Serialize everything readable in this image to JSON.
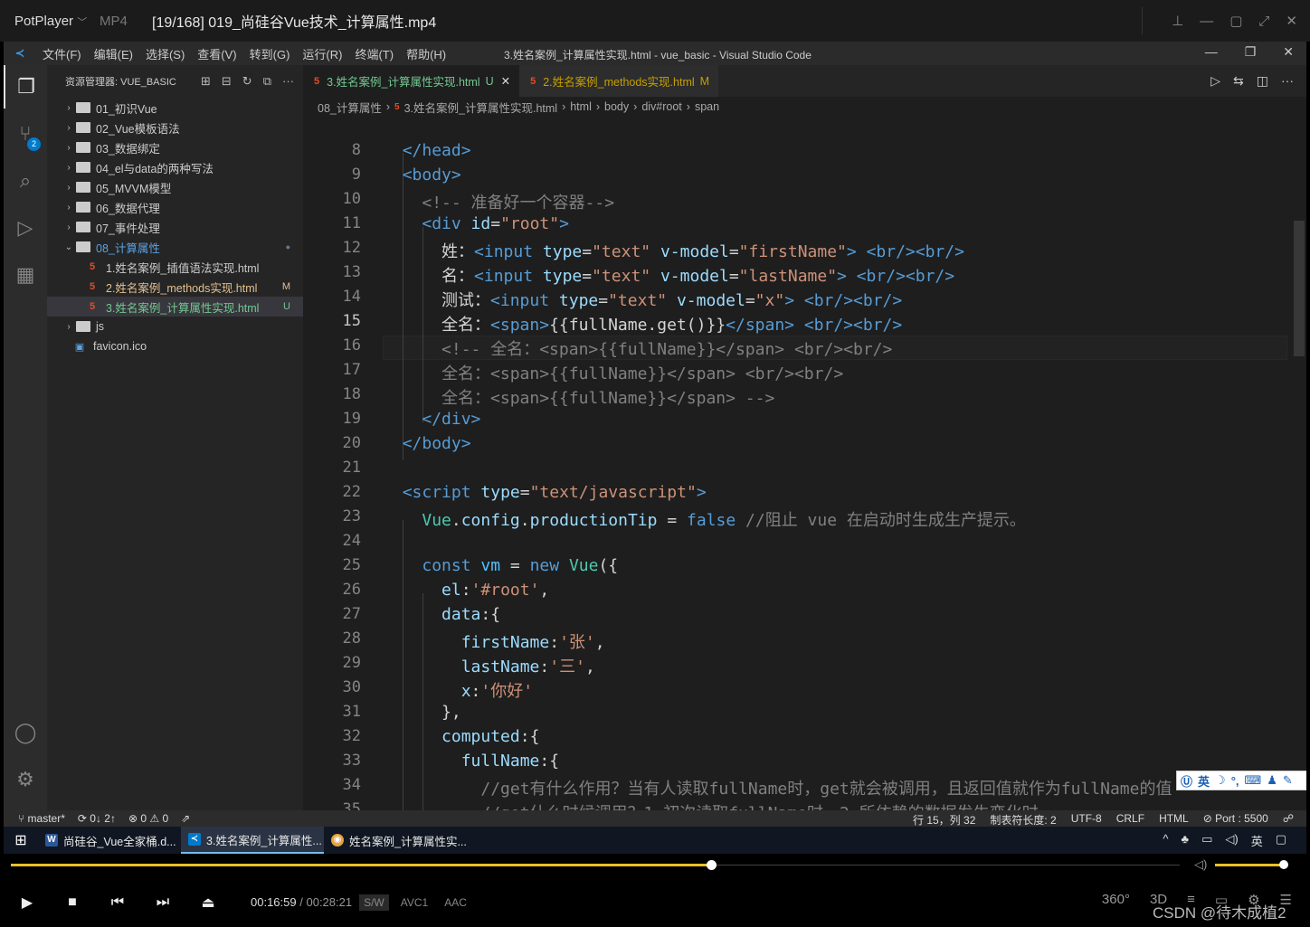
{
  "player": {
    "app_name": "PotPlayer",
    "app_chevron": "﹀",
    "format": "MP4",
    "title": "[19/168] 019_尚硅谷Vue技术_计算属性.mp4",
    "window_buttons": [
      "pin-icon",
      "minimize-icon",
      "maximize-icon",
      "fullscreen-icon",
      "close-icon"
    ],
    "window_button_glyphs": [
      "⊥",
      "—",
      "▢",
      "⤢",
      "✕"
    ],
    "time_current": "00:16:59",
    "time_separator": "/",
    "time_total": "00:28:21",
    "codec_sw": "S/W",
    "codec_video": "AVC1",
    "codec_audio": "AAC",
    "progress": 0.599,
    "volume": 0.95,
    "right_controls": [
      "360°",
      "3D",
      "≡",
      "▭",
      "⚙",
      "☰"
    ]
  },
  "vscode": {
    "logo_glyph": "≺",
    "menu": [
      "文件(F)",
      "编辑(E)",
      "选择(S)",
      "查看(V)",
      "转到(G)",
      "运行(R)",
      "终端(T)",
      "帮助(H)"
    ],
    "window_title": "3.姓名案例_计算属性实现.html - vue_basic - Visual Studio Code",
    "window_controls": [
      "—",
      "❐",
      "✕"
    ],
    "activity_glyphs": [
      "❐",
      "⑂",
      "⌕",
      "▷",
      "▦",
      "◯",
      "⚙"
    ],
    "scm_badge": "2",
    "explorer": {
      "header": "资源管理器: VUE_BASIC",
      "actions": [
        "⊞",
        "⊟",
        "↻",
        "⧉",
        "···"
      ],
      "items": [
        {
          "label": "01_初识Vue",
          "type": "folder",
          "chevron": "›"
        },
        {
          "label": "02_Vue模板语法",
          "type": "folder",
          "chevron": "›"
        },
        {
          "label": "03_数据绑定",
          "type": "folder",
          "chevron": "›"
        },
        {
          "label": "04_el与data的两种写法",
          "type": "folder",
          "chevron": "›"
        },
        {
          "label": "05_MVVM模型",
          "type": "folder",
          "chevron": "›"
        },
        {
          "label": "06_数据代理",
          "type": "folder",
          "chevron": "›"
        },
        {
          "label": "07_事件处理",
          "type": "folder",
          "chevron": "›"
        },
        {
          "label": "08_计算属性",
          "type": "folder-open",
          "chevron": "⌄",
          "flag": "●"
        },
        {
          "label": "1.姓名案例_插值语法实现.html",
          "type": "file"
        },
        {
          "label": "2.姓名案例_methods实现.html",
          "type": "file",
          "flag": "M"
        },
        {
          "label": "3.姓名案例_计算属性实现.html",
          "type": "file",
          "flag": "U"
        },
        {
          "label": "js",
          "type": "folder",
          "chevron": "›"
        },
        {
          "label": "favicon.ico",
          "type": "ico"
        }
      ]
    },
    "tabs": [
      {
        "label": "3.姓名案例_计算属性实现.html",
        "flag": "U",
        "close": "✕"
      },
      {
        "label": "2.姓名案例_methods实现.html",
        "flag": "M"
      }
    ],
    "tab_actions": [
      "▷",
      "⇆",
      "◫",
      "···"
    ],
    "breadcrumb": [
      "08_计算属性",
      "›",
      "3.姓名案例_计算属性实现.html",
      "›",
      "html",
      "›",
      "body",
      "›",
      "div#root",
      "›",
      "span"
    ],
    "editor": {
      "current_line": 15,
      "line_numbers": [
        "8",
        "9",
        "10",
        "11",
        "12",
        "13",
        "14",
        "15",
        "16",
        "17",
        "18",
        "19",
        "20",
        "21",
        "22",
        "23",
        "24",
        "25",
        "26",
        "27",
        "28",
        "29",
        "30",
        "31",
        "32",
        "33",
        "34",
        "35"
      ]
    },
    "ime_text": "英",
    "status": {
      "branch": "master*",
      "sync": "0↓ 2↑",
      "problems": "⊗ 0 ⚠ 0",
      "position": "行 15，列 32",
      "tab_size": "制表符长度: 2",
      "encoding": "UTF-8",
      "eol": "CRLF",
      "language": "HTML",
      "port": "Port : 5500"
    }
  },
  "taskbar": {
    "start_glyph": "⊞",
    "items": [
      {
        "label": "尚硅谷_Vue全家桶.d...",
        "icon": "W",
        "color": "#2b579a"
      },
      {
        "label": "3.姓名案例_计算属性...",
        "icon": "≺",
        "color": "#007acc"
      },
      {
        "label": "姓名案例_计算属性实...",
        "icon": "◉",
        "color": "#e8a33b"
      }
    ],
    "tray": [
      "^",
      "♣",
      "▭",
      "◁)",
      "英",
      "▢"
    ]
  },
  "watermark": "CSDN @待木成植2"
}
